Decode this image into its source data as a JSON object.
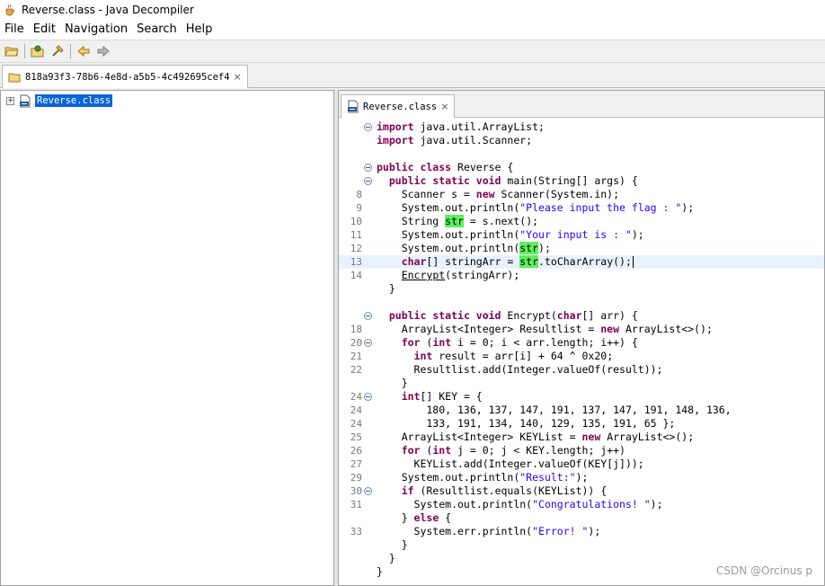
{
  "window": {
    "title": "Reverse.class - Java Decompiler"
  },
  "menu": [
    "File",
    "Edit",
    "Navigation",
    "Search",
    "Help"
  ],
  "toolbar": {
    "icons": [
      "open-file-icon",
      "open-type-icon",
      "open-type-hierarchy-icon",
      "back-icon",
      "forward-icon"
    ]
  },
  "archive_tab": {
    "label": "818a93f3-78b6-4e8d-a5b5-4c492695cef4"
  },
  "tree": {
    "expander": "+",
    "item": "Reverse.class"
  },
  "editor_tab": {
    "label": "Reverse.class"
  },
  "code_lines": [
    {
      "ln": "",
      "fold": true,
      "segs": [
        [
          "k",
          "import"
        ],
        [
          "t",
          " java.util.ArrayList;"
        ]
      ]
    },
    {
      "ln": "",
      "segs": [
        [
          "k",
          "import"
        ],
        [
          "t",
          " java.util.Scanner;"
        ]
      ]
    },
    {
      "ln": "",
      "segs": []
    },
    {
      "ln": "",
      "fold": true,
      "segs": [
        [
          "k",
          "public class"
        ],
        [
          "t",
          " Reverse {"
        ]
      ]
    },
    {
      "ln": "",
      "fold": true,
      "segs": [
        [
          "t",
          "  "
        ],
        [
          "k",
          "public static void"
        ],
        [
          "t",
          " main(String[] args) {"
        ]
      ]
    },
    {
      "ln": "8",
      "segs": [
        [
          "t",
          "    Scanner s = "
        ],
        [
          "k",
          "new"
        ],
        [
          "t",
          " Scanner(System.in);"
        ]
      ]
    },
    {
      "ln": "9",
      "segs": [
        [
          "t",
          "    System.out.println("
        ],
        [
          "s",
          "\"Please input the flag : \""
        ],
        [
          "t",
          ");"
        ]
      ]
    },
    {
      "ln": "10",
      "segs": [
        [
          "t",
          "    String "
        ],
        [
          "h",
          "str"
        ],
        [
          "t",
          " = s.next();"
        ]
      ]
    },
    {
      "ln": "11",
      "segs": [
        [
          "t",
          "    System.out.println("
        ],
        [
          "s",
          "\"Your input is : \""
        ],
        [
          "t",
          ");"
        ]
      ]
    },
    {
      "ln": "12",
      "segs": [
        [
          "t",
          "    System.out.println("
        ],
        [
          "h",
          "str"
        ],
        [
          "t",
          ");"
        ]
      ]
    },
    {
      "ln": "13",
      "current": true,
      "segs": [
        [
          "t",
          "    "
        ],
        [
          "k",
          "char"
        ],
        [
          "t",
          "[] stringArr = "
        ],
        [
          "h",
          "str"
        ],
        [
          "t",
          ".toCharArray();"
        ],
        [
          "c",
          ""
        ]
      ]
    },
    {
      "ln": "14",
      "segs": [
        [
          "t",
          "    "
        ],
        [
          "u",
          "Encrypt"
        ],
        [
          "t",
          "(stringArr);"
        ]
      ]
    },
    {
      "ln": "",
      "segs": [
        [
          "t",
          "  }"
        ]
      ]
    },
    {
      "ln": "",
      "segs": []
    },
    {
      "ln": "",
      "fold": true,
      "segs": [
        [
          "t",
          "  "
        ],
        [
          "k",
          "public static void"
        ],
        [
          "t",
          " Encrypt("
        ],
        [
          "k",
          "char"
        ],
        [
          "t",
          "[] arr) {"
        ]
      ]
    },
    {
      "ln": "18",
      "segs": [
        [
          "t",
          "    ArrayList<Integer> Resultlist = "
        ],
        [
          "k",
          "new"
        ],
        [
          "t",
          " ArrayList<>();"
        ]
      ]
    },
    {
      "ln": "20",
      "fold": true,
      "segs": [
        [
          "t",
          "    "
        ],
        [
          "k",
          "for"
        ],
        [
          "t",
          " ("
        ],
        [
          "k",
          "int"
        ],
        [
          "t",
          " i = 0; i < arr.length; i++) {"
        ]
      ]
    },
    {
      "ln": "21",
      "segs": [
        [
          "t",
          "      "
        ],
        [
          "k",
          "int"
        ],
        [
          "t",
          " result = arr[i] + 64 ^ 0x20;"
        ]
      ]
    },
    {
      "ln": "22",
      "segs": [
        [
          "t",
          "      Resultlist.add(Integer.valueOf(result));"
        ]
      ]
    },
    {
      "ln": "",
      "segs": [
        [
          "t",
          "    }"
        ]
      ]
    },
    {
      "ln": "24",
      "fold": true,
      "segs": [
        [
          "t",
          "    "
        ],
        [
          "k",
          "int"
        ],
        [
          "t",
          "[] KEY = {"
        ]
      ]
    },
    {
      "ln": "24",
      "segs": [
        [
          "t",
          "        180, 136, 137, 147, 191, 137, 147, 191, 148, 136,"
        ]
      ]
    },
    {
      "ln": "24",
      "segs": [
        [
          "t",
          "        133, 191, 134, 140, 129, 135, 191, 65 };"
        ]
      ]
    },
    {
      "ln": "25",
      "segs": [
        [
          "t",
          "    ArrayList<Integer> KEYList = "
        ],
        [
          "k",
          "new"
        ],
        [
          "t",
          " ArrayList<>();"
        ]
      ]
    },
    {
      "ln": "26",
      "segs": [
        [
          "t",
          "    "
        ],
        [
          "k",
          "for"
        ],
        [
          "t",
          " ("
        ],
        [
          "k",
          "int"
        ],
        [
          "t",
          " j = 0; j < KEY.length; j++)"
        ]
      ]
    },
    {
      "ln": "27",
      "segs": [
        [
          "t",
          "      KEYList.add(Integer.valueOf(KEY[j]));"
        ]
      ]
    },
    {
      "ln": "29",
      "segs": [
        [
          "t",
          "    System.out.println("
        ],
        [
          "s",
          "\"Result:\""
        ],
        [
          "t",
          ");"
        ]
      ]
    },
    {
      "ln": "30",
      "fold": true,
      "segs": [
        [
          "t",
          "    "
        ],
        [
          "k",
          "if"
        ],
        [
          "t",
          " (Resultlist.equals(KEYList)) {"
        ]
      ]
    },
    {
      "ln": "31",
      "segs": [
        [
          "t",
          "      System.out.println("
        ],
        [
          "s",
          "\"Congratulations! \""
        ],
        [
          "t",
          ");"
        ]
      ]
    },
    {
      "ln": "",
      "segs": [
        [
          "t",
          "    } "
        ],
        [
          "k",
          "else"
        ],
        [
          "t",
          " {"
        ]
      ]
    },
    {
      "ln": "33",
      "segs": [
        [
          "t",
          "      System.err.println("
        ],
        [
          "s",
          "\"Error! \""
        ],
        [
          "t",
          ");"
        ]
      ]
    },
    {
      "ln": "",
      "segs": [
        [
          "t",
          "    }"
        ]
      ]
    },
    {
      "ln": "",
      "segs": [
        [
          "t",
          "  }"
        ]
      ]
    },
    {
      "ln": "",
      "segs": [
        [
          "t",
          "}"
        ]
      ]
    }
  ],
  "watermark": "CSDN @Orcinus p"
}
